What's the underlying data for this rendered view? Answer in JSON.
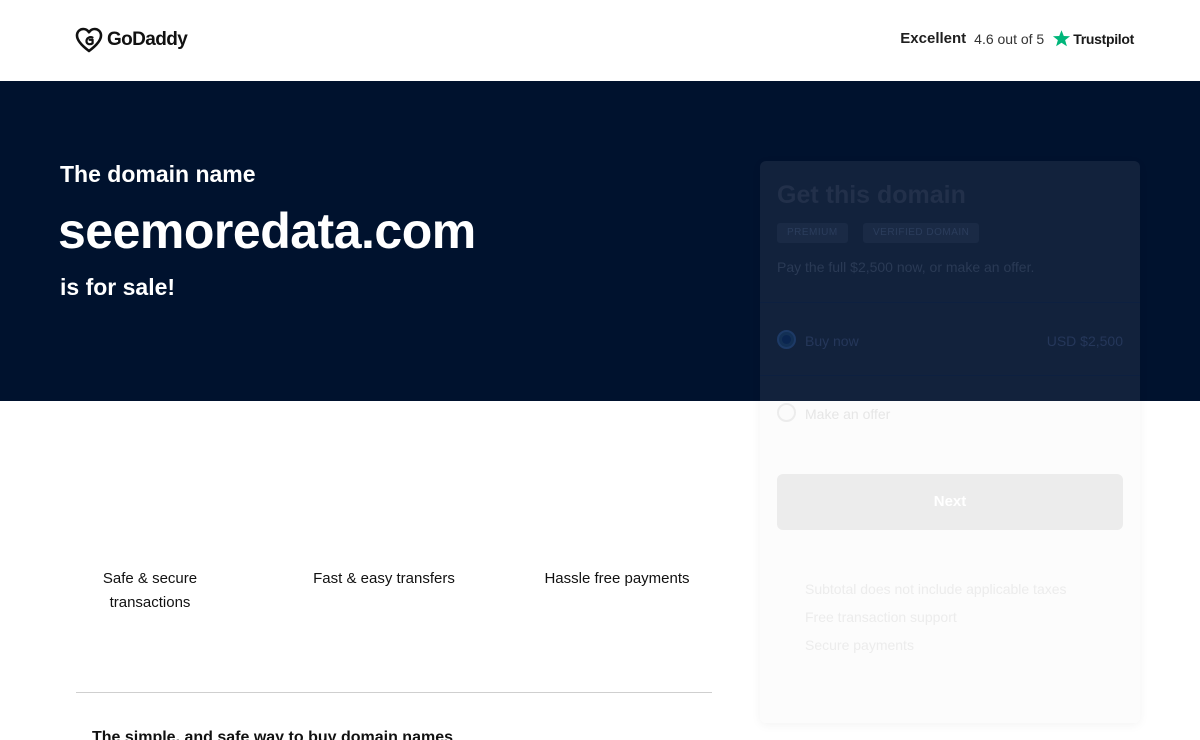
{
  "header": {
    "logo_text": "GoDaddy",
    "trustpilot": {
      "label": "Excellent",
      "rating": "4.6 out of 5",
      "brand": "Trustpilot",
      "star_color": "#00b67a"
    }
  },
  "hero": {
    "pre": "The domain name",
    "domain": "seemoredata.com",
    "post": "is for sale!",
    "background": "#00122e"
  },
  "features": [
    "Safe & secure transactions",
    "Fast & easy transfers",
    "Hassle free payments"
  ],
  "section": {
    "heading": "The simple, and safe way to buy domain names"
  },
  "card": {
    "title": "Get this domain",
    "badges": [
      "PREMIUM",
      "VERIFIED DOMAIN"
    ],
    "subtitle": "Pay the full $2,500 now, or make an offer.",
    "options": [
      {
        "label": "Buy now",
        "price": "USD $2,500",
        "selected": true
      },
      {
        "label": "Make an offer",
        "selected": false
      }
    ],
    "next_label": "Next",
    "notes": [
      "Subtotal does not include applicable taxes",
      "Free transaction support",
      "Secure payments"
    ]
  }
}
